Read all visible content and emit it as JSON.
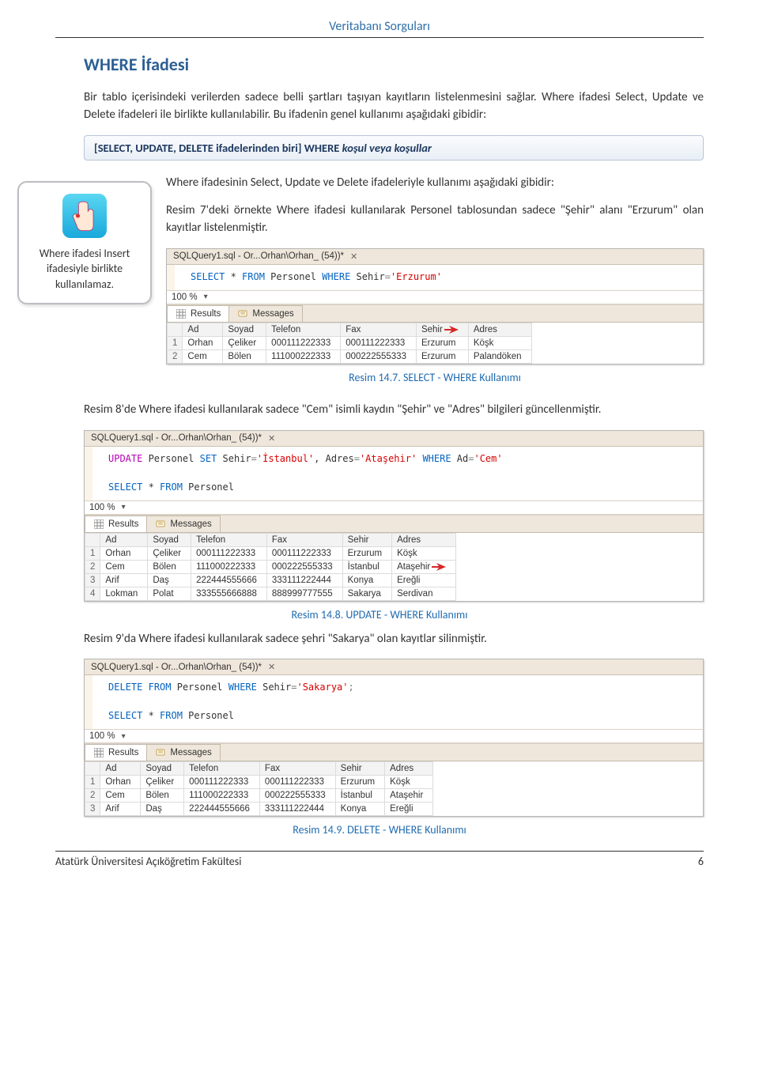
{
  "header": {
    "running_title": "Veritabanı Sorguları"
  },
  "section": {
    "title": "WHERE İfadesi"
  },
  "paragraphs": {
    "p1": "Bir tablo içerisindeki verilerden sadece belli şartları taşıyan kayıtların listelenmesini sağlar. Where ifadesi Select, Update ve Delete ifadeleri ile birlikte kullanılabilir. Bu ifadenin genel kullanımı aşağıdaki gibidir:",
    "p2a": "Where ifadesinin Select, Update ve Delete ifadeleriyle kullanımı aşağıdaki gibidir:",
    "p2b": "Resim 7'deki örnekte Where ifadesi kullanılarak Personel tablosundan sadece \"Şehir\" alanı \"Erzurum\" olan kayıtlar listelenmiştir.",
    "p3": "Resim 8'de Where ifadesi kullanılarak sadece \"Cem\" isimli kaydın \"Şehir\" ve \"Adres\" bilgileri güncellenmiştir.",
    "p4": "Resim 9'da Where ifadesi kullanılarak sadece şehri \"Sakarya\" olan kayıtlar silinmiştir."
  },
  "syntax": {
    "text_prefix": "[SELECT, UPDATE, DELETE ifadelerinden biri] WHERE ",
    "text_italic": "koşul veya koşullar"
  },
  "callout": {
    "text": "Where ifadesi Insert ifadesiyle birlikte kullanılamaz."
  },
  "captions": {
    "c1": "Resim 14.7. SELECT - WHERE Kullanımı",
    "c2": "Resim 14.8. UPDATE - WHERE Kullanımı",
    "c3": "Resim 14.9. DELETE - WHERE Kullanımı"
  },
  "footer": {
    "institution": "Atatürk Üniversitesi Açıköğretim Fakültesi",
    "page_number": "6"
  },
  "sql_common": {
    "tab_label": "SQLQuery1.sql - Or...Orhan\\Orhan_ (54))*",
    "close_glyph": "✕",
    "zoom": "100 %",
    "dropdown_glyph": "▾",
    "tab_results": "Results",
    "tab_messages": "Messages"
  },
  "shot1": {
    "code_lines": [
      {
        "tokens": [
          {
            "t": "SELECT",
            "c": "kw-blue"
          },
          {
            "t": " * "
          },
          {
            "t": "FROM",
            "c": "kw-blue"
          },
          {
            "t": " Personel "
          },
          {
            "t": "WHERE",
            "c": "kw-blue"
          },
          {
            "t": " Sehir"
          },
          {
            "t": "=",
            "c": "kw-gray"
          },
          {
            "t": "'Erzurum'",
            "c": "kw-red"
          }
        ]
      }
    ]
  },
  "shot2": {
    "code_lines": [
      {
        "tokens": [
          {
            "t": "UPDATE",
            "c": "kw-mag"
          },
          {
            "t": " Personel "
          },
          {
            "t": "SET",
            "c": "kw-blue"
          },
          {
            "t": " Sehir"
          },
          {
            "t": "=",
            "c": "kw-gray"
          },
          {
            "t": "'İstanbul'",
            "c": "kw-red"
          },
          {
            "t": ", "
          },
          {
            "t": "Adres"
          },
          {
            "t": "=",
            "c": "kw-gray"
          },
          {
            "t": "'Ataşehir'",
            "c": "kw-red"
          },
          {
            "t": " "
          },
          {
            "t": "WHERE",
            "c": "kw-blue"
          },
          {
            "t": " Ad"
          },
          {
            "t": "=",
            "c": "kw-gray"
          },
          {
            "t": "'Cem'",
            "c": "kw-red"
          }
        ]
      },
      {
        "tokens": []
      },
      {
        "tokens": [
          {
            "t": "SELECT",
            "c": "kw-blue"
          },
          {
            "t": " * "
          },
          {
            "t": "FROM",
            "c": "kw-blue"
          },
          {
            "t": " Personel"
          }
        ]
      }
    ]
  },
  "shot3": {
    "code_lines": [
      {
        "tokens": [
          {
            "t": "DELETE",
            "c": "kw-blue"
          },
          {
            "t": " "
          },
          {
            "t": "FROM",
            "c": "kw-blue"
          },
          {
            "t": " Personel "
          },
          {
            "t": "WHERE",
            "c": "kw-blue"
          },
          {
            "t": " Sehir"
          },
          {
            "t": "=",
            "c": "kw-gray"
          },
          {
            "t": "'Sakarya'",
            "c": "kw-red"
          },
          {
            "t": ";",
            "c": "kw-gray"
          }
        ]
      },
      {
        "tokens": []
      },
      {
        "tokens": [
          {
            "t": "SELECT",
            "c": "kw-blue"
          },
          {
            "t": " * "
          },
          {
            "t": "FROM",
            "c": "kw-blue"
          },
          {
            "t": " Personel"
          }
        ]
      }
    ]
  },
  "chart_data": [
    {
      "type": "table",
      "title": "Resim 14.7 — Results",
      "columns": [
        "",
        "Ad",
        "Soyad",
        "Telefon",
        "Fax",
        "Sehir",
        "Adres"
      ],
      "rows": [
        [
          "1",
          "Orhan",
          "Çeliker",
          "000111222333",
          "000111222333",
          "Erzurum",
          "Köşk"
        ],
        [
          "2",
          "Cem",
          "Bölen",
          "111000222333",
          "000222555333",
          "Erzurum",
          "Palandöken"
        ]
      ],
      "arrow_header_col": 5
    },
    {
      "type": "table",
      "title": "Resim 14.8 — Results",
      "columns": [
        "",
        "Ad",
        "Soyad",
        "Telefon",
        "Fax",
        "Sehir",
        "Adres"
      ],
      "rows": [
        [
          "1",
          "Orhan",
          "Çeliker",
          "000111222333",
          "000111222333",
          "Erzurum",
          "Köşk"
        ],
        [
          "2",
          "Cem",
          "Bölen",
          "111000222333",
          "000222555333",
          "İstanbul",
          "Ataşehir"
        ],
        [
          "3",
          "Arif",
          "Daş",
          "222444555666",
          "333111222444",
          "Konya",
          "Ereğli"
        ],
        [
          "4",
          "Lokman",
          "Polat",
          "333555666888",
          "888999777555",
          "Sakarya",
          "Serdivan"
        ]
      ],
      "arrow_row_col": [
        1,
        6
      ]
    },
    {
      "type": "table",
      "title": "Resim 14.9 — Results",
      "columns": [
        "",
        "Ad",
        "Soyad",
        "Telefon",
        "Fax",
        "Sehir",
        "Adres"
      ],
      "rows": [
        [
          "1",
          "Orhan",
          "Çeliker",
          "000111222333",
          "000111222333",
          "Erzurum",
          "Köşk"
        ],
        [
          "2",
          "Cem",
          "Bölen",
          "111000222333",
          "000222555333",
          "İstanbul",
          "Ataşehir"
        ],
        [
          "3",
          "Arif",
          "Daş",
          "222444555666",
          "333111222444",
          "Konya",
          "Ereğli"
        ]
      ]
    }
  ]
}
